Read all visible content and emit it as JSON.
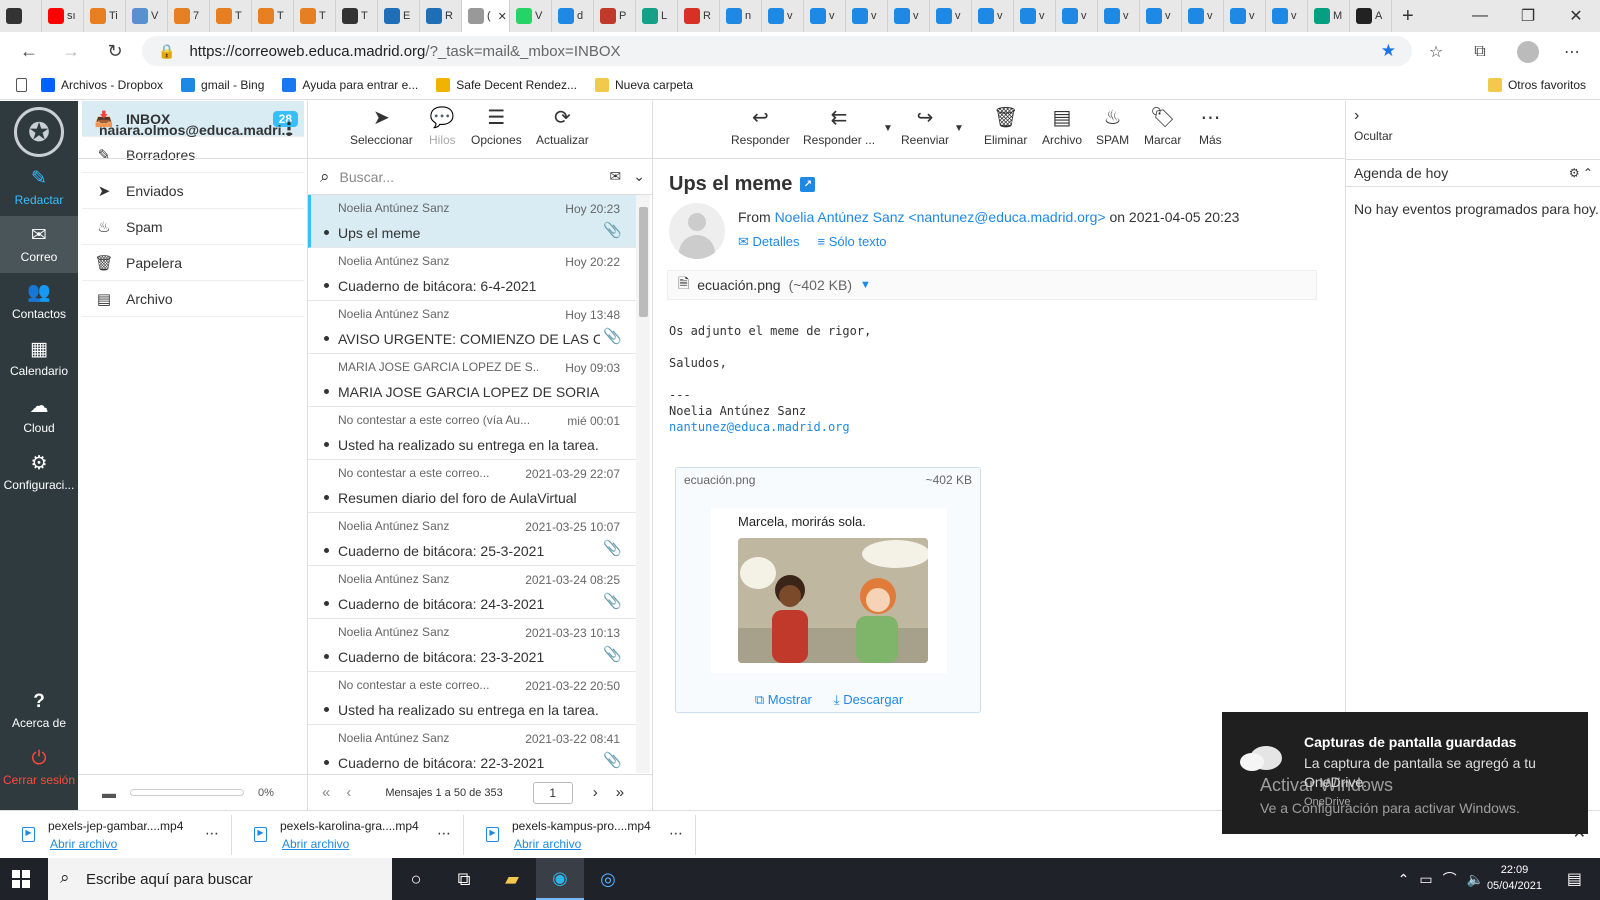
{
  "browser": {
    "tabs": [
      {
        "label": "",
        "icon": "window-icon",
        "color": "#333333"
      },
      {
        "label": "sı",
        "icon": "youtube-icon",
        "color": "#ff0000"
      },
      {
        "label": "Ti",
        "icon": "moodle-icon",
        "color": "#e67e22"
      },
      {
        "label": "V",
        "icon": "educamadrid-icon",
        "color": "#5a8fd0"
      },
      {
        "label": "7",
        "icon": "moodle-icon",
        "color": "#e67e22"
      },
      {
        "label": "T",
        "icon": "moodle-icon",
        "color": "#e67e22"
      },
      {
        "label": "T",
        "icon": "moodle-icon",
        "color": "#e67e22"
      },
      {
        "label": "T",
        "icon": "moodle-icon",
        "color": "#e67e22"
      },
      {
        "label": "T",
        "icon": "chrome-icon",
        "color": "#333333"
      },
      {
        "label": "E",
        "icon": "educamadrid-icon",
        "color": "#1e6fb8"
      },
      {
        "label": "R",
        "icon": "educamadrid-icon",
        "color": "#1e6fb8"
      },
      {
        "label": "(",
        "icon": "loading-icon",
        "color": "#999999"
      },
      {
        "label": "V",
        "icon": "whatsapp-icon",
        "color": "#25d366"
      },
      {
        "label": "d",
        "icon": "bing-icon",
        "color": "#1e88e5"
      },
      {
        "label": "P",
        "icon": "pdf-icon",
        "color": "#c0392b"
      },
      {
        "label": "L",
        "icon": "doc-icon",
        "color": "#16a085"
      },
      {
        "label": "R",
        "icon": "gmail-icon",
        "color": "#d93025"
      },
      {
        "label": "n",
        "icon": "bing-icon",
        "color": "#1e88e5"
      },
      {
        "label": "v",
        "icon": "bing-icon",
        "color": "#1e88e5"
      },
      {
        "label": "v",
        "icon": "bing-icon",
        "color": "#1e88e5"
      },
      {
        "label": "v",
        "icon": "bing-icon",
        "color": "#1e88e5"
      },
      {
        "label": "v",
        "icon": "bing-icon",
        "color": "#1e88e5"
      },
      {
        "label": "v",
        "icon": "bing-icon",
        "color": "#1e88e5"
      },
      {
        "label": "v",
        "icon": "bing-icon",
        "color": "#1e88e5"
      },
      {
        "label": "v",
        "icon": "bing-icon",
        "color": "#1e88e5"
      },
      {
        "label": "v",
        "icon": "bing-icon",
        "color": "#1e88e5"
      },
      {
        "label": "v",
        "icon": "bing-icon",
        "color": "#1e88e5"
      },
      {
        "label": "v",
        "icon": "bing-icon",
        "color": "#1e88e5"
      },
      {
        "label": "v",
        "icon": "bing-icon",
        "color": "#1e88e5"
      },
      {
        "label": "v",
        "icon": "bing-icon",
        "color": "#1e88e5"
      },
      {
        "label": "v",
        "icon": "bing-icon",
        "color": "#1e88e5"
      },
      {
        "label": "M",
        "icon": "pexels-icon",
        "color": "#05a081"
      },
      {
        "label": "A",
        "icon": "s-icon",
        "color": "#222222"
      }
    ],
    "url_host": "https://correoweb.educa.madrid.org",
    "url_path": "/?_task=mail&_mbox=INBOX",
    "bookmarks": [
      {
        "label": "Archivos - Dropbox",
        "icon": "dropbox-icon",
        "color": "#0061fe"
      },
      {
        "label": "gmail - Bing",
        "icon": "bing-icon",
        "color": "#1e88e5"
      },
      {
        "label": "Ayuda para entrar e...",
        "icon": "facebook-icon",
        "color": "#1877f2"
      },
      {
        "label": "Safe Decent Rendez...",
        "icon": "bookmark-icon",
        "color": "#f0b400"
      },
      {
        "label": "Nueva carpeta",
        "icon": "folder-icon",
        "color": "#f2c94c"
      }
    ],
    "other_bookmarks": "Otros favoritos"
  },
  "nav": {
    "compose": "Redactar",
    "mail": "Correo",
    "contacts": "Contactos",
    "calendar": "Calendario",
    "cloud": "Cloud",
    "settings": "Configuraci...",
    "about": "Acerca de",
    "logout": "Cerrar sesión"
  },
  "account": "naiara.olmos@educa.madri...",
  "folders": [
    {
      "label": "INBOX",
      "icon": "inbox-icon",
      "badge": "28"
    },
    {
      "label": "Borradores",
      "icon": "pencil-icon",
      "badge": ""
    },
    {
      "label": "Enviados",
      "icon": "send-icon",
      "badge": ""
    },
    {
      "label": "Spam",
      "icon": "flame-icon",
      "badge": ""
    },
    {
      "label": "Papelera",
      "icon": "trash-icon",
      "badge": ""
    },
    {
      "label": "Archivo",
      "icon": "archive-icon",
      "badge": ""
    }
  ],
  "quota": "0%",
  "list_toolbar": {
    "select": "Seleccionar",
    "threads": "Hilos",
    "options": "Opciones",
    "refresh": "Actualizar"
  },
  "search_placeholder": "Buscar...",
  "messages": [
    {
      "from": "Noelia Antúnez Sanz",
      "date": "Hoy 20:23",
      "subject": "Ups el meme",
      "attachment": true,
      "selected": true
    },
    {
      "from": "Noelia Antúnez Sanz",
      "date": "Hoy 20:22",
      "subject": "Cuaderno de bitácora: 6-4-2021",
      "attachment": false,
      "selected": false
    },
    {
      "from": "Noelia Antúnez Sanz",
      "date": "Hoy 13:48",
      "subject": "AVISO URGENTE: COMIENZO DE LAS CL...",
      "attachment": true,
      "selected": false
    },
    {
      "from": "MARIA JOSE GARCIA LOPEZ DE S...",
      "date": "Hoy 09:03",
      "subject": "MARIA JOSE GARCIA LOPEZ DE SORIA h...",
      "attachment": false,
      "selected": false
    },
    {
      "from": "No contestar a este correo (vía Au...",
      "date": "mié 00:01",
      "subject": "Usted ha realizado su entrega en la tarea...",
      "attachment": false,
      "selected": false
    },
    {
      "from": "No contestar a este correo...",
      "date": "2021-03-29 22:07",
      "subject": "Resumen diario del foro de AulaVirtual",
      "attachment": false,
      "selected": false
    },
    {
      "from": "Noelia Antúnez Sanz",
      "date": "2021-03-25 10:07",
      "subject": "Cuaderno de bitácora: 25-3-2021",
      "attachment": true,
      "selected": false
    },
    {
      "from": "Noelia Antúnez Sanz",
      "date": "2021-03-24 08:25",
      "subject": "Cuaderno de bitácora: 24-3-2021",
      "attachment": true,
      "selected": false
    },
    {
      "from": "Noelia Antúnez Sanz",
      "date": "2021-03-23 10:13",
      "subject": "Cuaderno de bitácora: 23-3-2021",
      "attachment": true,
      "selected": false
    },
    {
      "from": "No contestar a este correo...",
      "date": "2021-03-22 20:50",
      "subject": "Usted ha realizado su entrega en la tarea...",
      "attachment": false,
      "selected": false
    },
    {
      "from": "Noelia Antúnez Sanz",
      "date": "2021-03-22 08:41",
      "subject": "Cuaderno de bitácora: 22-3-2021",
      "attachment": true,
      "selected": false
    }
  ],
  "pager": {
    "count": "Mensajes 1 a 50 de 353",
    "page": "1"
  },
  "reader_toolbar": {
    "reply": "Responder",
    "reply_all": "Responder ...",
    "forward": "Reenviar",
    "delete": "Eliminar",
    "archive": "Archivo",
    "spam": "SPAM",
    "mark": "Marcar",
    "more": "Más"
  },
  "email": {
    "subject": "Ups el meme",
    "from_prefix": "From",
    "from_name": "Noelia Antúnez Sanz <nantunez@educa.madrid.org>",
    "date_text": "on 2021-04-05 20:23",
    "details": "Detalles",
    "plain_text": "Sólo texto",
    "attachment_name": "ecuación.png",
    "attachment_size": "(~402 KB)",
    "body_line1": "Os adjunto el meme de rigor,",
    "body_line2": "Saludos,",
    "sig_sep": "---",
    "sig_name": "Noelia Antúnez Sanz",
    "sig_email": "nantunez@educa.madrid.org",
    "card_name": "ecuación.png",
    "card_size": "~402 KB",
    "meme_caption": "Marcela, morirás sola.",
    "show": "Mostrar",
    "download": "Descargar"
  },
  "right_pane": {
    "hide": "Ocultar",
    "agenda_title": "Agenda de hoy",
    "agenda_empty": "No hay eventos programados para hoy."
  },
  "toast": {
    "title": "Capturas de pantalla guardadas",
    "body": "La captura de pantalla se agregó a tu OneDrive.",
    "source": "OneDrive"
  },
  "watermark": {
    "line1": "Activar Windows",
    "line2": "Ve a Configuración para activar Windows."
  },
  "downloads": [
    {
      "name": "pexels-jep-gambar....mp4",
      "action": "Abrir archivo"
    },
    {
      "name": "pexels-karolina-gra....mp4",
      "action": "Abrir archivo"
    },
    {
      "name": "pexels-kampus-pro....mp4",
      "action": "Abrir archivo"
    }
  ],
  "taskbar": {
    "search_placeholder": "Escribe aquí para buscar",
    "time": "22:09",
    "date": "05/04/2021"
  },
  "colors": {
    "accent": "#37beff",
    "link": "#1e88e5",
    "sidebar": "#2f3a3f"
  }
}
